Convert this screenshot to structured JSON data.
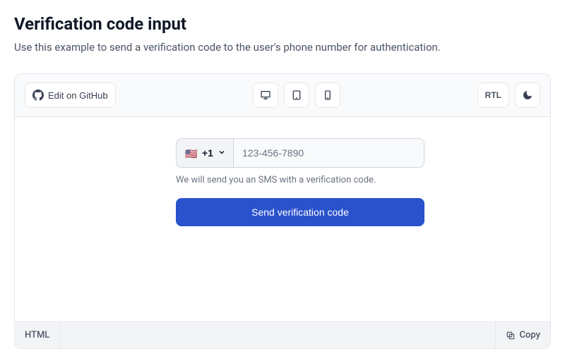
{
  "header": {
    "title": "Verification code input",
    "subtitle": "Use this example to send a verification code to the user's phone number for authentication."
  },
  "toolbar": {
    "edit_github_label": "Edit on GitHub",
    "rtl_label": "RTL"
  },
  "form": {
    "country_code": "+1",
    "country_flag": "🇺🇸",
    "phone_placeholder": "123-456-7890",
    "phone_value": "",
    "helper_text": "We will send you an SMS with a verification code.",
    "submit_label": "Send verification code"
  },
  "footer": {
    "tab_label": "HTML",
    "copy_label": "Copy"
  }
}
